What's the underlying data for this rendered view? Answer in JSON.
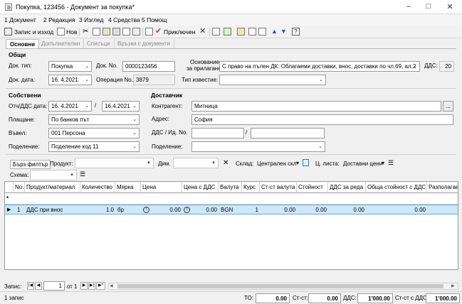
{
  "window": {
    "title": "Покупка, 123456 - Документ за покупка*"
  },
  "menu": [
    "1 Документ",
    "2 Редакция",
    "3 Изглед",
    "4 Средства",
    "5 Помощ"
  ],
  "toolbar": {
    "save_exit": "Запис и изход",
    "new": "Нов",
    "posted": "Приключен"
  },
  "tabs": [
    "Основни",
    "Допълнителни",
    "Списъци",
    "Връзки с документи"
  ],
  "general": {
    "title": "Общи",
    "doc_type_label": "Док. тип:",
    "doc_type": "Покупка",
    "doc_no_label": "Док. No.",
    "doc_no": "0000123456",
    "basis_label_1": "Основание",
    "basis_label_2": "за прилагане:",
    "basis": "С право на пълен ДК: Облагаеми доставки, внос, доставки по чл.69, ал.2",
    "vat_label": "ДДС:",
    "vat": "20",
    "doc_date_label": "Док. дата:",
    "doc_date": "16. 4.2021",
    "op_no_label": "Операция No.",
    "op_no": "3879",
    "notice_type_label": "Тип известие:",
    "notice_type": ""
  },
  "own": {
    "title": "Собствени",
    "vat_date_label": "Отч/ДДС дата:",
    "vat_date_from": "16. 4.2021",
    "vat_date_to": "16.4.2021",
    "payment_label": "Плащане:",
    "payment": "По банков път",
    "entered_label": "Въвел:",
    "entered": "001 Персона",
    "division_label": "Поделение:",
    "division": "Поделение код 11"
  },
  "supplier": {
    "title": "Доставчик",
    "contractor_label": "Контрагент:",
    "contractor": "Митница",
    "ellipsis": "...",
    "address_label": "Адрес:",
    "address": "София",
    "vat_id_label": "ДДС / Ид. No.",
    "vat_id_1": "",
    "vat_id_2": "",
    "division_label": "Поделение:",
    "division": ""
  },
  "filter": {
    "quick_filter": "Бърз филтър",
    "product_label": "Продукт:",
    "dim_label": "Дим.",
    "warehouse_label": "Склад:",
    "warehouse": "Централен скл",
    "pricelist_label": "Ц. листа:",
    "pricelist": "Доставни цени",
    "scheme_label": "Схема:"
  },
  "grid": {
    "headers": [
      "No.",
      "Продукт/материал",
      "Количество",
      "Мярка",
      "Цена",
      "Цена с ДДС",
      "Валута",
      "Курс",
      "Ст-ст валута",
      "Стойност",
      "ДДС за реда",
      "Обща стойност с ДДС",
      "Разполагаемо"
    ],
    "new_row_marker": "*",
    "row": {
      "no": "1",
      "product": "ДДС при внос",
      "qty": "1.0",
      "unit": "бр",
      "price": "0.00",
      "price_vat": "0.00",
      "currency": "BGN",
      "rate": "1",
      "cur_value": "0.00",
      "value": "0.00",
      "row_vat": "0.00",
      "total_vat": "0.00"
    }
  },
  "nav": {
    "label": "Запис:",
    "current": "1",
    "of": "от 1"
  },
  "status": {
    "records": "1 запис",
    "to_label": "ТО:",
    "to": "0.00",
    "cost_label": "Ст-ст:",
    "cost": "0.00",
    "vat_label": "ДДС:",
    "vat": "1'000.00",
    "cost_vat_label": "Ст-ст с ДДС:",
    "cost_vat": "1'000.00"
  },
  "colors": {
    "selected_row": "#cde7fb",
    "posted_check": "#d03030",
    "arrow_blue": "#1f4fb8"
  }
}
